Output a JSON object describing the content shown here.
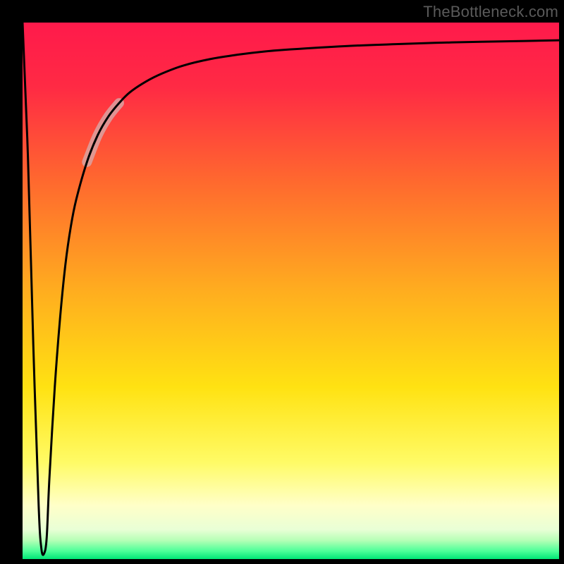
{
  "attribution": "TheBottleneck.com",
  "gradient": {
    "stops": [
      {
        "offset": 0.0,
        "color": "#ff1a4b"
      },
      {
        "offset": 0.12,
        "color": "#ff2a44"
      },
      {
        "offset": 0.3,
        "color": "#ff6a2e"
      },
      {
        "offset": 0.5,
        "color": "#ffad1f"
      },
      {
        "offset": 0.68,
        "color": "#ffe212"
      },
      {
        "offset": 0.82,
        "color": "#fffb66"
      },
      {
        "offset": 0.9,
        "color": "#ffffc8"
      },
      {
        "offset": 0.945,
        "color": "#e9ffd6"
      },
      {
        "offset": 0.965,
        "color": "#b6ffb6"
      },
      {
        "offset": 0.985,
        "color": "#4dff99"
      },
      {
        "offset": 1.0,
        "color": "#00e676"
      }
    ]
  },
  "highlight": {
    "color": "#d9a6a6",
    "opacity": 0.82,
    "width": 14,
    "t_start": 0.12,
    "t_end": 0.19
  },
  "chart_data": {
    "type": "line",
    "title": "",
    "xlabel": "",
    "ylabel": "",
    "xlim": [
      0,
      1
    ],
    "ylim": [
      0,
      100
    ],
    "series": [
      {
        "name": "bottleneck-curve",
        "x": [
          0.0,
          0.01,
          0.02,
          0.03,
          0.035,
          0.04,
          0.045,
          0.05,
          0.06,
          0.07,
          0.08,
          0.09,
          0.1,
          0.12,
          0.14,
          0.16,
          0.18,
          0.2,
          0.23,
          0.26,
          0.3,
          0.35,
          0.4,
          0.45,
          0.5,
          0.6,
          0.7,
          0.8,
          0.9,
          1.0
        ],
        "y": [
          100.0,
          75.0,
          40.0,
          10.0,
          2.0,
          1.0,
          4.0,
          15.0,
          32.0,
          45.0,
          55.0,
          62.0,
          67.0,
          74.0,
          79.0,
          82.5,
          85.0,
          87.0,
          89.0,
          90.5,
          92.0,
          93.2,
          94.0,
          94.6,
          95.0,
          95.6,
          96.0,
          96.3,
          96.5,
          96.7
        ]
      }
    ]
  }
}
